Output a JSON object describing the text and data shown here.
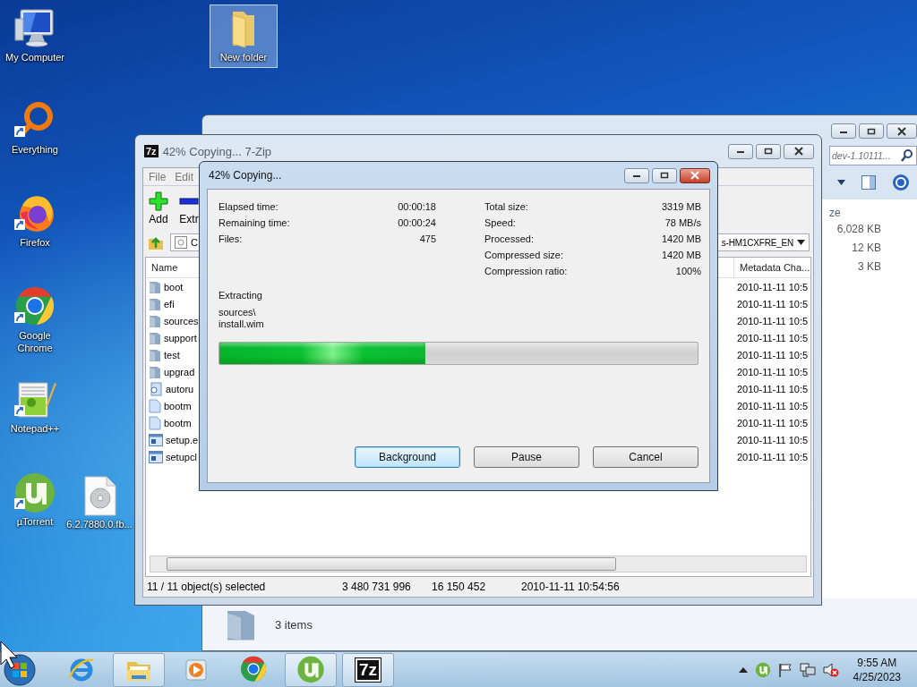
{
  "desktop_icons": [
    {
      "label": "My Computer",
      "kind": "computer",
      "shortcut": false,
      "selected": false
    },
    {
      "label": "Everything",
      "kind": "everything",
      "shortcut": true,
      "selected": false
    },
    {
      "label": "Firefox",
      "kind": "firefox",
      "shortcut": true,
      "selected": false
    },
    {
      "label": "Google Chrome",
      "kind": "chrome",
      "shortcut": true,
      "selected": false
    },
    {
      "label": "Notepad++",
      "kind": "notepad",
      "shortcut": true,
      "selected": false
    },
    {
      "label": "µTorrent",
      "kind": "utorrent",
      "shortcut": true,
      "selected": false
    },
    {
      "label": "6.2.7880.0.fb...",
      "kind": "disc",
      "shortcut": false,
      "selected": false
    },
    {
      "label": "New folder",
      "kind": "folder",
      "shortcut": false,
      "selected": true
    }
  ],
  "explorer_window": {
    "search": {
      "placeholder": "dev-1.10111..."
    },
    "columns": [
      {
        "label": "ze"
      }
    ],
    "sizes": [
      "6,028 KB",
      "12 KB",
      "3 KB"
    ],
    "status": "3 items"
  },
  "zip_window": {
    "logo": "7z",
    "title": "42% Copying... 7-Zip",
    "menu": [
      "File",
      "Edit"
    ],
    "toolbar": [
      {
        "label": "Add",
        "kind": "add"
      },
      {
        "label": "Extr",
        "kind": "extract"
      }
    ],
    "path_start": "C",
    "path_end": "s-HM1CXFRE_EN",
    "columns": [
      {
        "label": "Name"
      },
      {
        "label": "Metadata Cha..."
      }
    ],
    "rows": [
      {
        "name": "boot",
        "kind": "folder",
        "date": "2010-11-11 10:5"
      },
      {
        "name": "efi",
        "kind": "folder",
        "date": "2010-11-11 10:5"
      },
      {
        "name": "sources",
        "kind": "folder",
        "date": "2010-11-11 10:5"
      },
      {
        "name": "support",
        "kind": "folder",
        "date": "2010-11-11 10:5"
      },
      {
        "name": "test",
        "kind": "folder",
        "date": "2010-11-11 10:5"
      },
      {
        "name": "upgrad",
        "kind": "folder",
        "date": "2010-11-11 10:5"
      },
      {
        "name": "autoru",
        "kind": "config",
        "date": "2010-11-11 10:5"
      },
      {
        "name": "bootm",
        "kind": "file",
        "date": "2010-11-11 10:5"
      },
      {
        "name": "bootm",
        "kind": "file",
        "date": "2010-11-11 10:5"
      },
      {
        "name": "setup.e",
        "kind": "exe",
        "date": "2010-11-11 10:5"
      },
      {
        "name": "setupcl",
        "kind": "exe",
        "date": "2010-11-11 10:5"
      }
    ],
    "status": [
      "11 / 11 object(s) selected",
      "3 480 731 996",
      "16 150 452",
      "2010-11-11 10:54:56"
    ]
  },
  "dialog": {
    "title": "42% Copying...",
    "left_stats": [
      {
        "label": "Elapsed time:",
        "value": "00:00:18"
      },
      {
        "label": "Remaining time:",
        "value": "00:00:24"
      },
      {
        "label": "Files:",
        "value": "475"
      }
    ],
    "right_stats": [
      {
        "label": "Total size:",
        "value": "3319 MB"
      },
      {
        "label": "Speed:",
        "value": "78 MB/s"
      },
      {
        "label": "Processed:",
        "value": "1420 MB"
      },
      {
        "label": "Compressed size:",
        "value": "1420 MB"
      },
      {
        "label": "Compression ratio:",
        "value": "100%"
      }
    ],
    "operation": "Extracting",
    "path_lines": [
      "sources\\",
      "install.wim"
    ],
    "progress": {
      "level": 0.43
    },
    "buttons": [
      {
        "label": "Background",
        "default": true
      },
      {
        "label": "Pause",
        "default": false
      },
      {
        "label": "Cancel",
        "default": false
      }
    ]
  },
  "taskbar": {
    "apps": [
      {
        "kind": "ie",
        "active": false
      },
      {
        "kind": "explorer",
        "active": true
      },
      {
        "kind": "media",
        "active": false
      },
      {
        "kind": "chrome",
        "active": false
      },
      {
        "kind": "utorrent",
        "active": true
      },
      {
        "kind": "sevenzip",
        "active": true,
        "logo": "7z"
      }
    ],
    "tray": [
      {
        "kind": "show-hidden"
      },
      {
        "kind": "utorrent"
      },
      {
        "kind": "flag"
      },
      {
        "kind": "network"
      },
      {
        "kind": "volume-muted"
      }
    ],
    "time": "9:55 AM",
    "date": "4/25/2023"
  }
}
